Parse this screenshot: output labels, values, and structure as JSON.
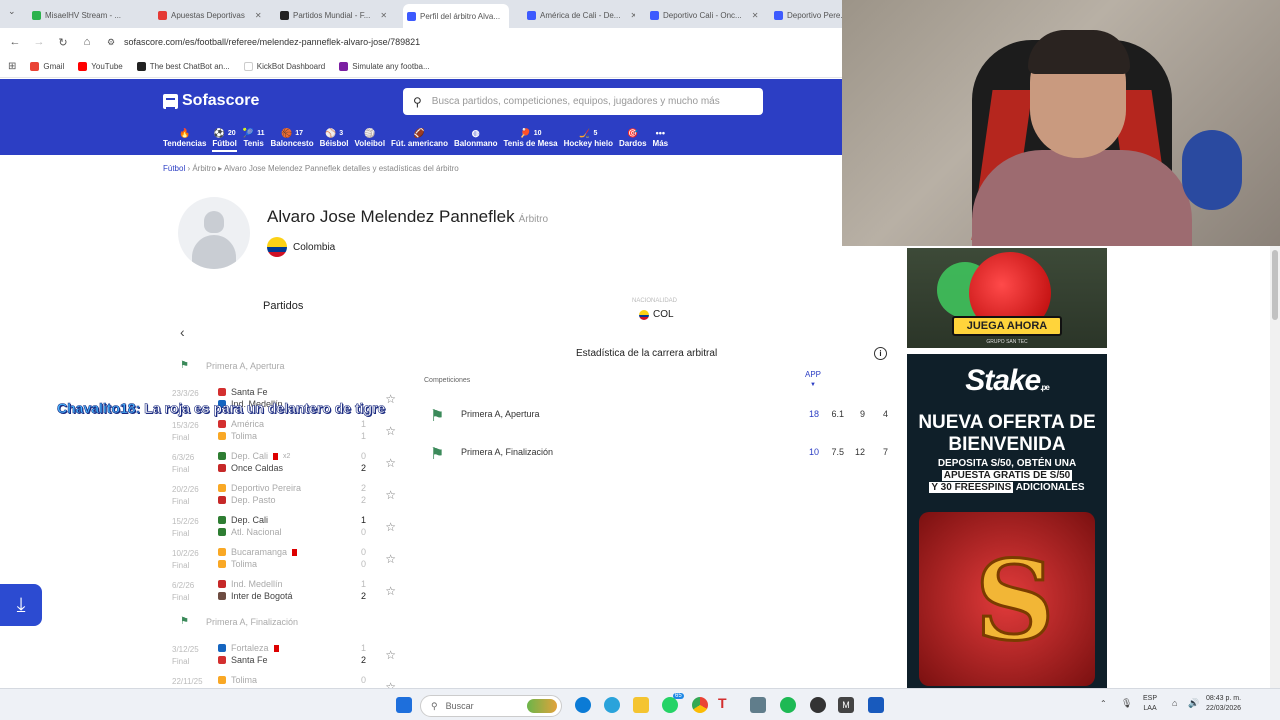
{
  "browser": {
    "tabs": [
      "MisaelHV Stream - ...",
      "Apuestas Deportivas",
      "Partidos Mundial - F...",
      "Perfil del árbitro Alva...",
      "América de Cali - De...",
      "Deportivo Cali - Onc...",
      "Deportivo Pere..."
    ],
    "tab_colors": [
      "#2bb24c",
      "#e53935",
      "#222222",
      "#3d5afe",
      "#3d5afe",
      "#3d5afe",
      "#3d5afe"
    ],
    "url": "sofascore.com/es/football/referee/melendez-panneflek-alvaro-jose/789821",
    "bookmarks": [
      "Gmail",
      "YouTube",
      "The best ChatBot an...",
      "KickBot Dashboard",
      "Simulate any footba..."
    ]
  },
  "site": {
    "logo": "Sofascore",
    "search_placeholder": "Busca partidos, competiciones, equipos, jugadores y mucho más",
    "sports": [
      {
        "label": "Tendencias",
        "icon": "🔥",
        "count": ""
      },
      {
        "label": "Fútbol",
        "icon": "⚽",
        "count": "20"
      },
      {
        "label": "Tenis",
        "icon": "🎾",
        "count": "11"
      },
      {
        "label": "Baloncesto",
        "icon": "🏀",
        "count": "17"
      },
      {
        "label": "Béisbol",
        "icon": "⚾",
        "count": "3"
      },
      {
        "label": "Voleibol",
        "icon": "🏐",
        "count": ""
      },
      {
        "label": "Fút. americano",
        "icon": "🏈",
        "count": ""
      },
      {
        "label": "Balonmano",
        "icon": "⚽",
        "count": ""
      },
      {
        "label": "Tenis de Mesa",
        "icon": "🏓",
        "count": "10"
      },
      {
        "label": "Hockey hielo",
        "icon": "🏒",
        "count": "5"
      },
      {
        "label": "Dardos",
        "icon": "🎯",
        "count": ""
      },
      {
        "label": "Más",
        "icon": "•••",
        "count": ""
      }
    ]
  },
  "breadcrumb": {
    "a": "Fútbol",
    "b": "Árbitro",
    "c": "Alvaro Jose Melendez Panneflek detalles y estadísticas del árbitro"
  },
  "referee": {
    "name": "Alvaro Jose Melendez Panneflek",
    "role": "Árbitro",
    "country": "Colombia"
  },
  "matches": {
    "title": "Partidos",
    "nationality_label": "NACIONALIDAD",
    "nationality": "COL",
    "groups": [
      {
        "competition": "Primera A, Apertura",
        "rows": [
          {
            "date": "23/3/26",
            "status": "",
            "home": "Santa Fe",
            "away": "Ind. Medellín",
            "hs": "",
            "as": "",
            "home_color": "#d32f2f",
            "away_color": "#1565c0"
          },
          {
            "date": "15/3/26",
            "status": "Final",
            "home": "América",
            "away": "Tolima",
            "hs": "1",
            "as": "1",
            "home_color": "#d32f2f",
            "away_color": "#f9a825"
          },
          {
            "date": "6/3/26",
            "status": "Final",
            "home": "Dep. Cali",
            "away": "Once Caldas",
            "hs": "0",
            "as": "2",
            "home_color": "#2e7d32",
            "away_color": "#c62828",
            "home_note": "x2"
          },
          {
            "date": "20/2/26",
            "status": "Final",
            "home": "Deportivo Pereira",
            "away": "Dep. Pasto",
            "hs": "2",
            "as": "2",
            "home_color": "#f9a825",
            "away_color": "#c62828"
          },
          {
            "date": "15/2/26",
            "status": "Final",
            "home": "Dep. Cali",
            "away": "Atl. Nacional",
            "hs": "1",
            "as": "0",
            "home_color": "#2e7d32",
            "away_color": "#2e7d32"
          },
          {
            "date": "10/2/26",
            "status": "Final",
            "home": "Bucaramanga",
            "away": "Tolima",
            "hs": "0",
            "as": "0",
            "home_color": "#f9a825",
            "away_color": "#f9a825"
          },
          {
            "date": "6/2/26",
            "status": "Final",
            "home": "Ind. Medellín",
            "away": "Inter de Bogotá",
            "hs": "1",
            "as": "2",
            "home_color": "#c62828",
            "away_color": "#6d4c41"
          }
        ]
      },
      {
        "competition": "Primera A, Finalización",
        "rows": [
          {
            "date": "3/12/25",
            "status": "Final",
            "home": "Fortaleza",
            "away": "Santa Fe",
            "hs": "1",
            "as": "2",
            "home_color": "#1565c0",
            "away_color": "#d32f2f"
          },
          {
            "date": "22/11/25",
            "status": "",
            "home": "Tolima",
            "away": "",
            "hs": "0",
            "as": "",
            "home_color": "#f9a825",
            "away_color": "#fff"
          }
        ]
      }
    ]
  },
  "chat": {
    "user": "Chavalito18:",
    "message": "La roja es para un delantero de tigre"
  },
  "career": {
    "title": "Estadística de la carrera arbitral",
    "competitions_label": "Competiciones",
    "app_label": "APP",
    "rows": [
      {
        "name": "Primera A, Apertura",
        "app": "18",
        "c1": "6.1",
        "c2": "9",
        "c3": "4"
      },
      {
        "name": "Primera A, Finalización",
        "app": "10",
        "c1": "7.5",
        "c2": "12",
        "c3": "7"
      }
    ]
  },
  "ads": {
    "ad1_button": "JUEGA AHORA",
    "ad1_small": "GRUPO SAN TEC",
    "ad2_logo": "Stake",
    "ad2_sub": ".pe",
    "ad2_headline": "NUEVA OFERTA DE BIENVENIDA",
    "ad2_body_a": "DEPOSITA S/50, OBTÉN UNA",
    "ad2_body_b": "APUESTA GRATIS DE S/50",
    "ad2_body_c": "Y 30 FREESPINS",
    "ad2_body_d": "ADICIONALES",
    "ad2_letter": "S"
  },
  "taskbar": {
    "search": "Buscar",
    "lang_a": "ESP",
    "lang_b": "LAA",
    "time": "08:43 p. m.",
    "date": "22/03/2026",
    "badge": "65"
  }
}
